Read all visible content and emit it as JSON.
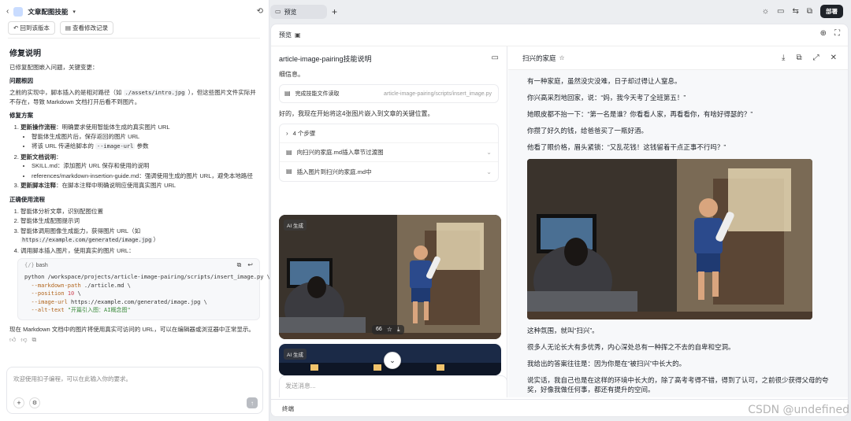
{
  "left": {
    "title": "文章配图技能",
    "top_buttons": [
      "回到该版本",
      "查看修改记录"
    ],
    "heading": "修复说明",
    "intro": "已修复配图嵌入问题，关键变更：",
    "problem_title": "问题根因",
    "problem_text_1": "之前的实现中，脚本插入的是相对路径（如",
    "problem_code": "./assets/intro.jpg",
    "problem_text_2": "），但这些图片文件实际并不存在，导致 Markdown 文档打开后看不到图片。",
    "fix_title": "修复方案",
    "fix_items": [
      {
        "label": "更新操作流程",
        "text": "：明确要求使用智能体生成的真实图片 URL",
        "subs": [
          {
            "text": "智能体生成图片后，保存返回的图片 URL"
          },
          {
            "text": "将该 URL 传递给脚本的",
            "code": "--image-url",
            "text2": "参数"
          }
        ]
      },
      {
        "label": "更新文档说明",
        "text": "：",
        "subs": [
          {
            "text": "SKILL.md：添加图片 URL 保存和使用的说明"
          },
          {
            "text": "references/markdown-insertion-guide.md：强调使用生成的图片 URL，避免本地路径"
          }
        ]
      },
      {
        "label": "更新脚本注释",
        "text": "：在脚本注释中明确说明应使用真实图片 URL",
        "subs": []
      }
    ],
    "correct_title": "正确使用流程",
    "correct_items": [
      "智能体分析文章，识别配图位置",
      "智能体生成配图提示词",
      "智能体调用图像生成能力，获得图片 URL（如",
      "调用脚本插入图片，使用真实的图片 URL："
    ],
    "correct_url": "https://example.com/generated/image.jpg",
    "correct_url_tail": "）",
    "code_lang": "bash",
    "code_lines": [
      {
        "t": "python /workspace/projects/article-image-pairing/scripts/insert_image.py \\"
      },
      {
        "t": "  --markdown-path ./article.md \\",
        "flag": "--markdown-path"
      },
      {
        "t": "  --position 10 \\",
        "flag": "--position"
      },
      {
        "t": "  --image-url https://example.com/generated/image.jpg \\",
        "flag": "--image-url"
      },
      {
        "t": "  --alt-text \"开篇引入图：AI概念图\"",
        "flag": "--alt-text"
      }
    ],
    "summary": "现在 Markdown 文档中的图片将使用真实可访问的 URL，可以在编辑器或浏览器中正常显示。",
    "input_placeholder": "欢迎使用扣子编程，可以在此输入你的要求。"
  },
  "topbar": {
    "tab_label": "预览",
    "deploy_label": "部署"
  },
  "preview": {
    "header_label": "预览",
    "chat": {
      "title": "article-image-pairing技能说明",
      "msg1": "细信息。",
      "tool_label": "完成技能文件读取",
      "tool_path": "article-image-pairing/scripts/insert_image.py",
      "msg2": "好的，我现在开始将这4张图片嵌入到文章的关键位置。",
      "steps_label": "4 个步骤",
      "steps": [
        "向扫兴的家庭.md插入章节过渡图",
        "插入图片到扫兴的家庭.md中"
      ],
      "ai_badge": "AI 生成",
      "image_count": "66",
      "input_placeholder": "发送消息..."
    },
    "doc": {
      "title": "扫兴的家庭",
      "paras_before": [
        "有一种家庭，虽然没灾没难，日子却过得让人窒息。",
        "你兴高采烈地回家，说：“妈，我今天考了全班第五！”",
        "她眼皮都不抬一下：“第一名是谁？你看看人家，再看看你，有啥好得瑟的？”",
        "你攒了好久的钱，给爸爸买了一瓶好酒。",
        "他看了眼价格，眉头紧锁：“又乱花钱！这钱留着干点正事不行吗？”"
      ],
      "paras_after": [
        "这种氛围，就叫“扫兴”。",
        "很多人无论长大有多优秀，内心深处总有一种挥之不去的自卑和空洞。",
        "我给出的答案往往是：因为你是在“被扫兴”中长大的。",
        "说实话，我自己也是在这样的环境中长大的，除了高考考得不错，得到了认可，之前很少获得父母的夸奖，好像我做任何事，都还有提升的空间。"
      ]
    },
    "terminal_label": "终端"
  },
  "watermark": "CSDN @undefined",
  "colors": {
    "deploy_bg": "#1f2329",
    "accent": "#3370ff"
  }
}
